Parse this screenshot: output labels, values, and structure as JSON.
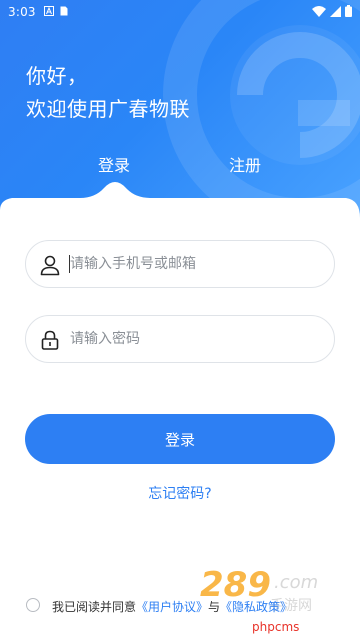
{
  "status_bar": {
    "time": "3:03"
  },
  "greeting": {
    "line1": "你好，",
    "line2": "欢迎使用广春物联"
  },
  "tabs": {
    "login_label": "登录",
    "register_label": "注册"
  },
  "form": {
    "phone_placeholder": "请输入手机号或邮箱",
    "password_placeholder": "请输入密码",
    "login_button_label": "登录",
    "forgot_label": "忘记密码?"
  },
  "agreement": {
    "prefix": "我已阅读并同意",
    "user_agreement": "《用户协议》",
    "conjunction": "与",
    "privacy_policy": "《隐私政策》"
  },
  "watermark": {
    "text": "phpcms"
  },
  "colors": {
    "primary": "#2d7ff3",
    "header_gradient_start": "#2f7ef3",
    "header_gradient_end": "#4aa3ff",
    "watermark": "#e8332a"
  }
}
